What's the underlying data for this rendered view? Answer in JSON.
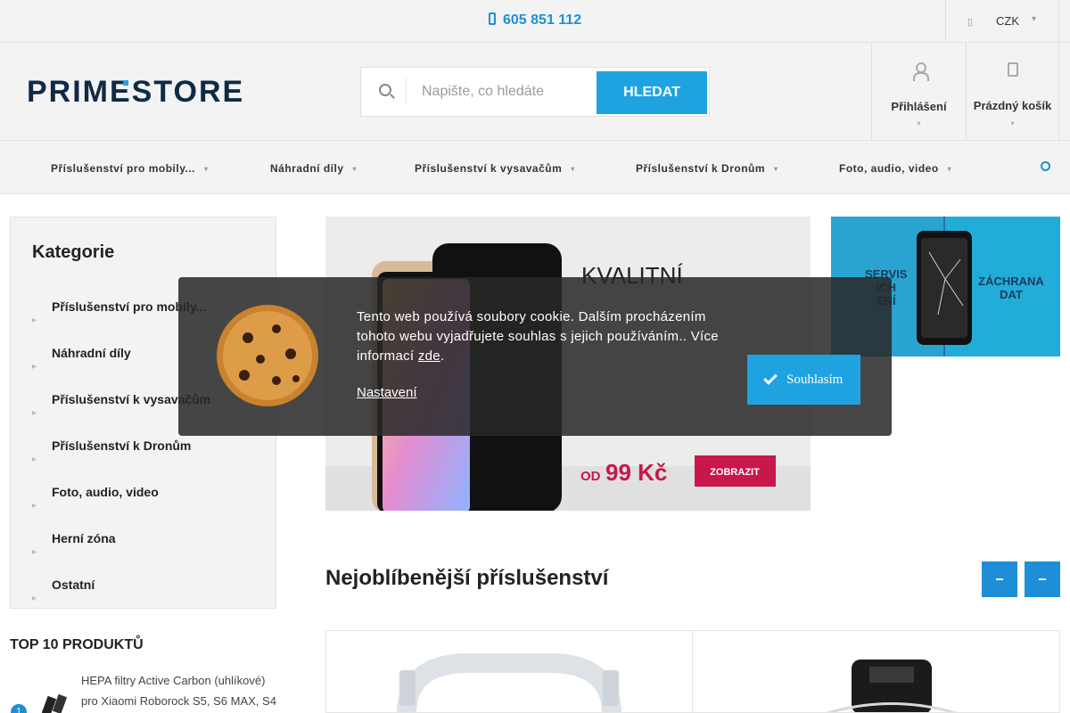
{
  "topbar": {
    "phone": "605 851 112",
    "currency": "CZK"
  },
  "header": {
    "logo_text": "PRIMESTORE",
    "search_placeholder": "Napište, co hledáte",
    "search_button": "HLEDAT",
    "login_label": "Přihlášení",
    "cart_label": "Prázdný košík"
  },
  "nav": {
    "items": [
      {
        "label": "Příslušenství pro mobily..."
      },
      {
        "label": "Náhradní díly"
      },
      {
        "label": "Příslušenství k vysavačům"
      },
      {
        "label": "Příslušenství k Dronům"
      },
      {
        "label": "Foto, audio, video"
      }
    ]
  },
  "sidebar": {
    "title": "Kategorie",
    "categories": [
      {
        "label": "Příslušenství pro mobily..."
      },
      {
        "label": "Náhradní díly"
      },
      {
        "label": "Příslušenství k vysavačům"
      },
      {
        "label": "Příslušenství k Dronům"
      },
      {
        "label": "Foto, audio, video"
      },
      {
        "label": "Herní zóna"
      },
      {
        "label": "Ostatní"
      }
    ],
    "top10_title": "TOP 10 PRODUKTŮ",
    "top10_first": {
      "rank": "1",
      "name": "HEPA filtry Active Carbon (uhlíkové) pro Xiaomi Roborock S5, S6 MAX, S4"
    }
  },
  "banner_main": {
    "headline": "KVALITNÍ",
    "price_prefix": "OD",
    "price": "99 Kč",
    "cta": "ZOBRAZIT"
  },
  "banner_side": {
    "left_text": "SERVIS ...ÍCH ...ENÍ",
    "right_text": "ZÁCHRANA DAT"
  },
  "section": {
    "title": "Nejoblíbenější příslušenství"
  },
  "cookie": {
    "text": "Tento web používá soubory cookie. Dalším procházením tohoto webu vyjadřujete souhlas s jejich používáním.. Více informací",
    "link": "zde",
    "settings": "Nastavení",
    "agree": "Souhlasím"
  },
  "colors": {
    "accent": "#1fa3e0",
    "cta_red": "#c8174a",
    "dialog_bg": "#2d2d2d"
  }
}
